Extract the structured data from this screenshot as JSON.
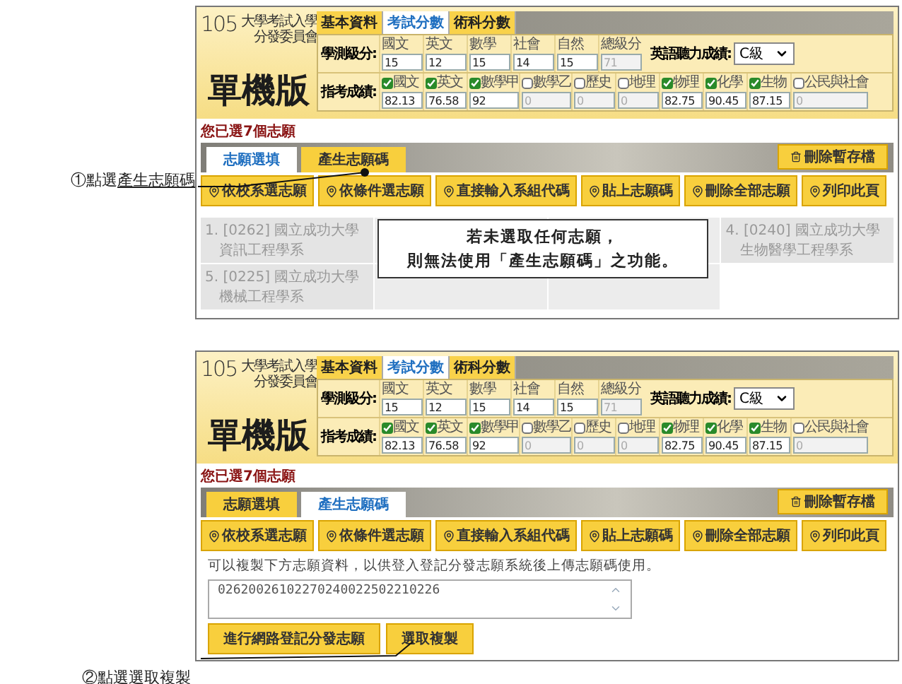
{
  "sections": [
    {
      "annotation": {
        "prefix": "①點選",
        "target": "產生志願碼"
      },
      "header": {
        "logo": {
          "number": "105",
          "org_line1": "大學考試入學",
          "org_line2": "分發委員會",
          "edition": "單機版"
        },
        "tabs": [
          {
            "label": "基本資料",
            "selected": false
          },
          {
            "label": "考試分數",
            "selected": true
          },
          {
            "label": "術科分數",
            "selected": false
          }
        ],
        "gsat": {
          "label": "學測級分:",
          "subjects": [
            {
              "label": "國文",
              "value": "15",
              "disabled": false
            },
            {
              "label": "英文",
              "value": "12",
              "disabled": false
            },
            {
              "label": "數學",
              "value": "15",
              "disabled": false
            },
            {
              "label": "社會",
              "value": "14",
              "disabled": false
            },
            {
              "label": "自然",
              "value": "15",
              "disabled": false
            },
            {
              "label": "總級分",
              "value": "71",
              "disabled": true
            }
          ]
        },
        "listening": {
          "label": "英語聽力成績:",
          "value": "C級"
        },
        "ast": {
          "label": "指考成績:",
          "subjects": [
            {
              "label": "國文",
              "checked": true,
              "value": "82.13"
            },
            {
              "label": "英文",
              "checked": true,
              "value": "76.58"
            },
            {
              "label": "數學甲",
              "checked": true,
              "value": "92"
            },
            {
              "label": "數學乙",
              "checked": false,
              "value": "0"
            },
            {
              "label": "歷史",
              "checked": false,
              "value": "0"
            },
            {
              "label": "地理",
              "checked": false,
              "value": "0"
            },
            {
              "label": "物理",
              "checked": true,
              "value": "82.75"
            },
            {
              "label": "化學",
              "checked": true,
              "value": "90.45"
            },
            {
              "label": "生物",
              "checked": true,
              "value": "87.15"
            },
            {
              "label": "公民與社會",
              "checked": false,
              "value": "0"
            }
          ]
        }
      },
      "count_text": "您已選7個志願",
      "view_tabs": [
        {
          "label": "志願選填",
          "selected": true
        },
        {
          "label": "產生志願碼",
          "selected": false
        }
      ],
      "delete_draft": "刪除暫存檔",
      "actions": [
        "依校系選志願",
        "依條件選志願",
        "直接輸入系組代碼",
        "貼上志願碼",
        "刪除全部志願",
        "列印此頁"
      ],
      "content": {
        "kind": "choices",
        "items": [
          {
            "covered": false,
            "line1": "1. [0262]  國立成功大學",
            "line2": "資訊工程學系"
          },
          {
            "covered": true
          },
          {
            "covered": true
          },
          {
            "covered": false,
            "line1": "4. [0240]  國立成功大學",
            "line2": "生物醫學工程學系"
          },
          {
            "covered": false,
            "line1": "5. [0225]  國立成功大學",
            "line2": "機械工程學系"
          },
          {
            "covered": true
          },
          {
            "covered": true
          }
        ],
        "message": [
          "若未選取任何志願，",
          "則無法使用「產生志願碼」之功能。"
        ]
      }
    },
    {
      "annotation": {
        "prefix": "②點選",
        "target": "選取複製"
      },
      "header": {
        "logo": {
          "number": "105",
          "org_line1": "大學考試入學",
          "org_line2": "分發委員會",
          "edition": "單機版"
        },
        "tabs": [
          {
            "label": "基本資料",
            "selected": false
          },
          {
            "label": "考試分數",
            "selected": true
          },
          {
            "label": "術科分數",
            "selected": false
          }
        ],
        "gsat": {
          "label": "學測級分:",
          "subjects": [
            {
              "label": "國文",
              "value": "15",
              "disabled": false
            },
            {
              "label": "英文",
              "value": "12",
              "disabled": false
            },
            {
              "label": "數學",
              "value": "15",
              "disabled": false
            },
            {
              "label": "社會",
              "value": "14",
              "disabled": false
            },
            {
              "label": "自然",
              "value": "15",
              "disabled": false
            },
            {
              "label": "總級分",
              "value": "71",
              "disabled": true
            }
          ]
        },
        "listening": {
          "label": "英語聽力成績:",
          "value": "C級"
        },
        "ast": {
          "label": "指考成績:",
          "subjects": [
            {
              "label": "國文",
              "checked": true,
              "value": "82.13"
            },
            {
              "label": "英文",
              "checked": true,
              "value": "76.58"
            },
            {
              "label": "數學甲",
              "checked": true,
              "value": "92"
            },
            {
              "label": "數學乙",
              "checked": false,
              "value": "0"
            },
            {
              "label": "歷史",
              "checked": false,
              "value": "0"
            },
            {
              "label": "地理",
              "checked": false,
              "value": "0"
            },
            {
              "label": "物理",
              "checked": true,
              "value": "82.75"
            },
            {
              "label": "化學",
              "checked": true,
              "value": "90.45"
            },
            {
              "label": "生物",
              "checked": true,
              "value": "87.15"
            },
            {
              "label": "公民與社會",
              "checked": false,
              "value": "0"
            }
          ]
        }
      },
      "count_text": "您已選7個志願",
      "view_tabs": [
        {
          "label": "志願選填",
          "selected": false
        },
        {
          "label": "產生志願碼",
          "selected": true
        }
      ],
      "delete_draft": "刪除暫存檔",
      "actions": [
        "依校系選志願",
        "依條件選志願",
        "直接輸入系組代碼",
        "貼上志願碼",
        "刪除全部志願",
        "列印此頁"
      ],
      "content": {
        "kind": "code",
        "note": "可以複製下方志願資料，以供登入登記分發志願系統後上傳志願碼使用。",
        "code": "02620026102270240022502210226",
        "buttons": [
          "進行網路登記分發志願",
          "選取複製"
        ]
      }
    }
  ]
}
